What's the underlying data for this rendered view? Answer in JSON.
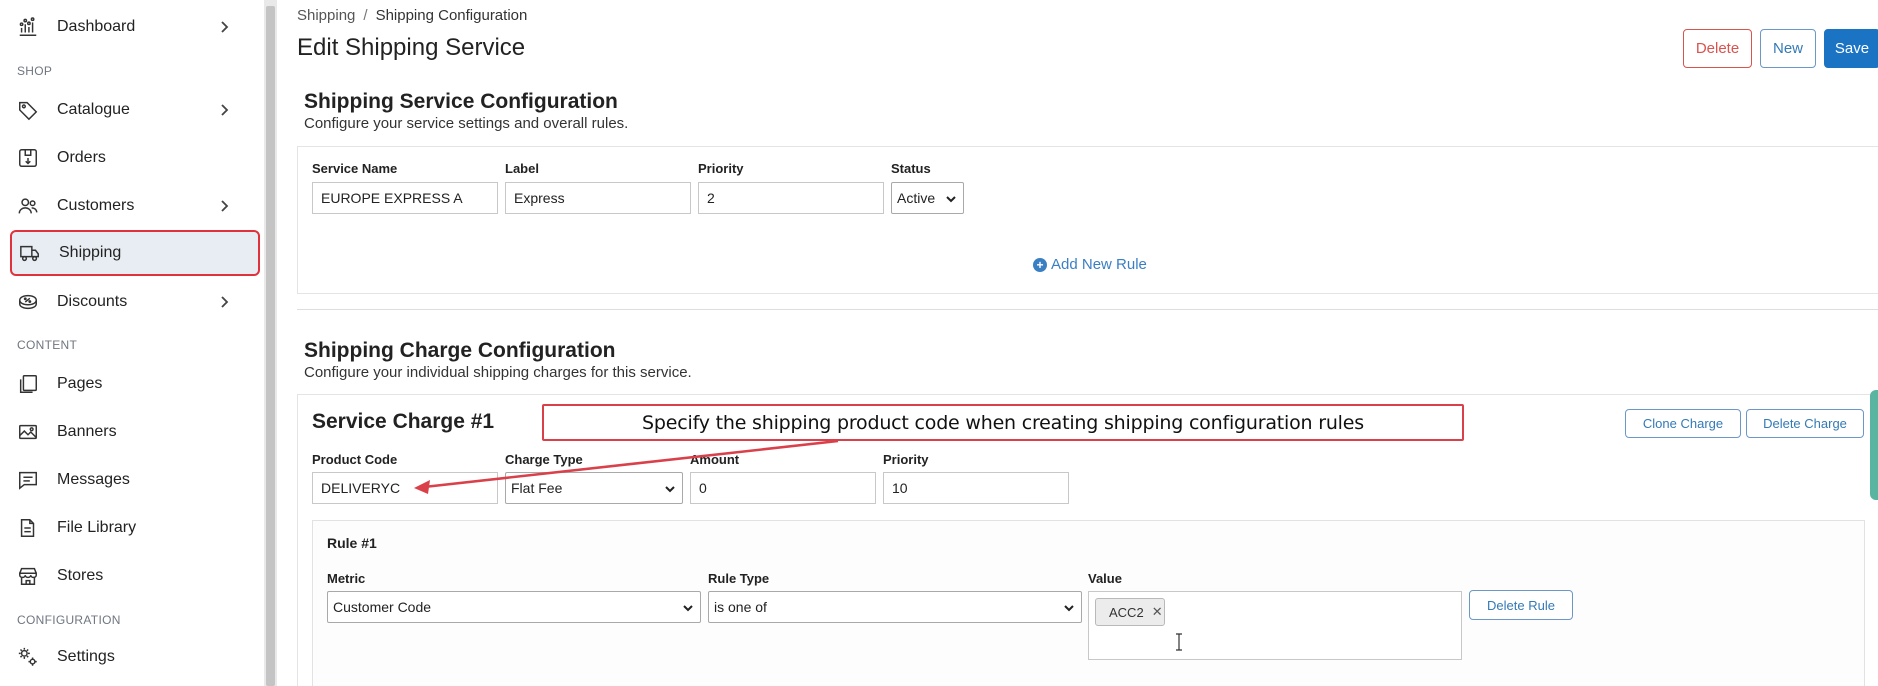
{
  "sidebar": {
    "items": [
      {
        "label": "Dashboard",
        "icon": "dashboard-icon"
      },
      {
        "label": "Catalogue",
        "icon": "tag-icon"
      },
      {
        "label": "Orders",
        "icon": "orders-box-icon"
      },
      {
        "label": "Customers",
        "icon": "customers-icon"
      },
      {
        "label": "Shipping",
        "icon": "truck-icon"
      },
      {
        "label": "Discounts",
        "icon": "discount-icon"
      },
      {
        "label": "Pages",
        "icon": "pages-icon"
      },
      {
        "label": "Banners",
        "icon": "banners-icon"
      },
      {
        "label": "Messages",
        "icon": "messages-icon"
      },
      {
        "label": "File Library",
        "icon": "file-library-icon"
      },
      {
        "label": "Stores",
        "icon": "store-icon"
      },
      {
        "label": "Settings",
        "icon": "settings-gears-icon"
      }
    ],
    "sections": {
      "shop": "SHOP",
      "content": "CONTENT",
      "configuration": "CONFIGURATION"
    }
  },
  "breadcrumb": {
    "parent": "Shipping",
    "separator": "/",
    "current": "Shipping Configuration"
  },
  "page_title": "Edit Shipping Service",
  "actions": {
    "delete": "Delete",
    "new": "New",
    "save": "Save"
  },
  "service_config": {
    "title": "Shipping Service Configuration",
    "subtitle": "Configure your service settings and overall rules.",
    "fields": {
      "service_name": {
        "label": "Service Name",
        "value": "EUROPE EXPRESS A"
      },
      "label": {
        "label": "Label",
        "value": "Express"
      },
      "priority": {
        "label": "Priority",
        "value": "2"
      },
      "status": {
        "label": "Status",
        "value": "Active"
      }
    },
    "add_rule": "Add New Rule"
  },
  "charge_config": {
    "title": "Shipping Charge Configuration",
    "subtitle": "Configure your individual shipping charges for this service.",
    "charge": {
      "title": "Service Charge #1",
      "clone": "Clone Charge",
      "delete": "Delete Charge",
      "fields": {
        "product_code": {
          "label": "Product Code",
          "value": "DELIVERYC"
        },
        "charge_type": {
          "label": "Charge Type",
          "value": "Flat Fee"
        },
        "amount": {
          "label": "Amount",
          "value": "0"
        },
        "priority": {
          "label": "Priority",
          "value": "10"
        }
      },
      "rule": {
        "title": "Rule #1",
        "metric": {
          "label": "Metric",
          "value": "Customer Code"
        },
        "rule_type": {
          "label": "Rule Type",
          "value": "is one of"
        },
        "value": {
          "label": "Value",
          "tags": [
            "ACC2"
          ]
        },
        "delete": "Delete Rule"
      }
    }
  },
  "annotation": {
    "text": "Specify the shipping product code when creating shipping configuration rules",
    "color": "#d9404a"
  },
  "colors": {
    "primary": "#1b73c4",
    "danger": "#d9534f",
    "link": "#337ab7",
    "active_outline": "#e0323c"
  }
}
